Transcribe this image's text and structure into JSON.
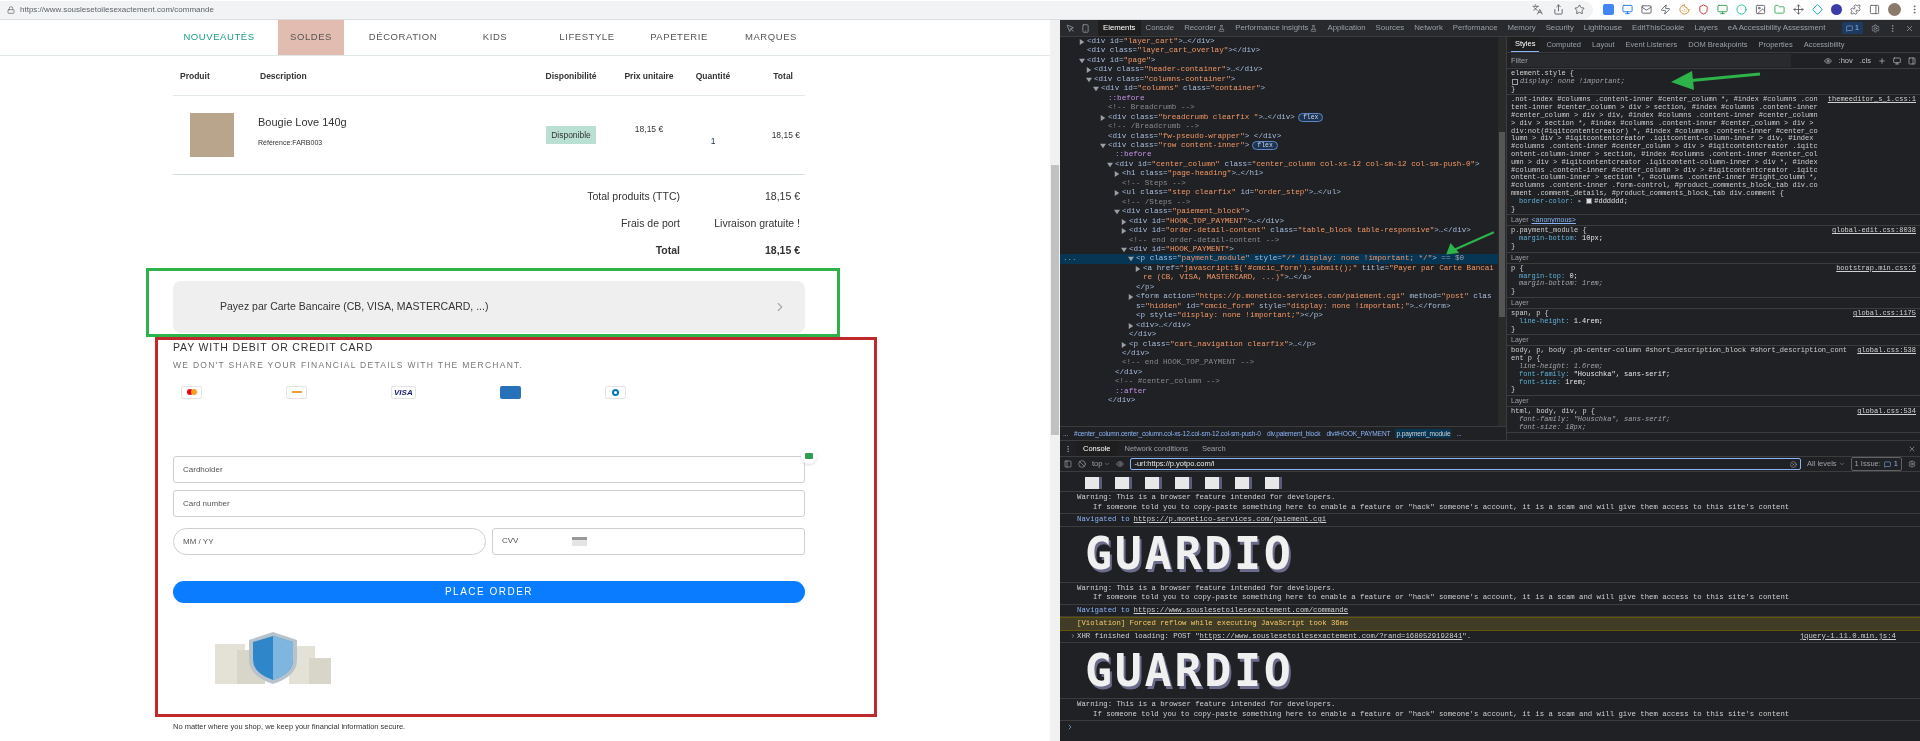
{
  "browser": {
    "url": "https://www.souslesetoilesexactement.com/commande"
  },
  "page": {
    "nav": [
      {
        "label": "NOUVEAUTÉS",
        "selected": false,
        "highlighted": true
      },
      {
        "label": "SOLDES",
        "selected": true,
        "highlighted": false
      },
      {
        "label": "DÉCORATION",
        "selected": false,
        "highlighted": false
      },
      {
        "label": "KIDS",
        "selected": false,
        "highlighted": false
      },
      {
        "label": "LIFESTYLE",
        "selected": false,
        "highlighted": false
      },
      {
        "label": "PAPETERIE",
        "selected": false,
        "highlighted": false
      },
      {
        "label": "MARQUES",
        "selected": false,
        "highlighted": false
      }
    ],
    "table": {
      "columns": [
        "Produit",
        "Description",
        "Disponibilité",
        "Prix unitaire",
        "Quantité",
        "Total"
      ],
      "rows": [
        {
          "product": "Bougie Love 140g",
          "reference": "Référence:FARB003",
          "availability": "Disponible",
          "unit_price": "18,15 €",
          "quantity": "1",
          "total": "18,15 €"
        }
      ]
    },
    "totals": [
      {
        "label": "Total produits (TTC)",
        "value": "18,15 €",
        "emphasis": false
      },
      {
        "label": "Frais de port",
        "value": "Livraison gratuite !",
        "emphasis": false
      },
      {
        "label": "Total",
        "value": "18,15 €",
        "emphasis": true
      }
    ],
    "payment_option": "Payez par Carte Bancaire (CB, VISA, MASTERCARD, ...)",
    "card_form": {
      "title": "PAY WITH DEBIT OR CREDIT CARD",
      "subtitle": "WE DON'T SHARE YOUR FINANCIAL DETAILS WITH THE MERCHANT.",
      "logos": [
        {
          "kind": "mastercard"
        },
        {
          "kind": "maestro"
        },
        {
          "kind": "visa",
          "text": "VISA"
        },
        {
          "kind": "amex"
        },
        {
          "kind": "diners"
        }
      ],
      "fields": [
        {
          "placeholder": "Cardholder"
        },
        {
          "placeholder": "Card number"
        }
      ],
      "expiry": {
        "placeholder": "MM / YY"
      },
      "cvv": {
        "placeholder": "CVV"
      },
      "button": "PLACE ORDER"
    },
    "note": "No matter where you shop, we keep your financial information secure."
  },
  "devtools": {
    "tabs": [
      {
        "label": "Elements",
        "selected": true,
        "experimental": false
      },
      {
        "label": "Console",
        "selected": false,
        "experimental": false
      },
      {
        "label": "Recorder",
        "selected": false,
        "experimental": true
      },
      {
        "label": "Performance insights",
        "selected": false,
        "experimental": true
      },
      {
        "label": "Application",
        "selected": false,
        "experimental": false
      },
      {
        "label": "Sources",
        "selected": false,
        "experimental": false
      },
      {
        "label": "Network",
        "selected": false,
        "experimental": false
      },
      {
        "label": "Performance",
        "selected": false,
        "experimental": false
      },
      {
        "label": "Memory",
        "selected": false,
        "experimental": false
      },
      {
        "label": "Security",
        "selected": false,
        "experimental": false
      },
      {
        "label": "Lighthouse",
        "selected": false,
        "experimental": false
      },
      {
        "label": "EditThisCookie",
        "selected": false,
        "experimental": false
      },
      {
        "label": "Layers",
        "selected": false,
        "experimental": false
      },
      {
        "label": "eA Accessibility Assessment",
        "selected": false,
        "experimental": false
      }
    ],
    "issues_count": "1",
    "tree": [
      {
        "text": "<div id=\"layer_cart\">…</div>",
        "kind": "tag",
        "expanded": false,
        "selected": false
      },
      {
        "text": "<div class=\"layer_cart_overlay\"></div>",
        "kind": "tag",
        "selected": false
      },
      {
        "text": "<div id=\"page\">",
        "kind": "tag",
        "expanded": true,
        "selected": false,
        "children": [
          {
            "text": "<div class=\"header-container\">…</div>",
            "kind": "tag",
            "expanded": false,
            "selected": false
          },
          {
            "text": "<div class=\"columns-container\">",
            "kind": "tag",
            "expanded": true,
            "selected": false,
            "children": [
              {
                "text": "<div id=\"columns\" class=\"container\">",
                "kind": "tag",
                "expanded": true,
                "selected": false,
                "children": [
                  {
                    "text": "::before",
                    "kind": "pseudo",
                    "selected": false
                  },
                  {
                    "text": "<!-- Breadcrumb -->",
                    "kind": "comment",
                    "selected": false
                  },
                  {
                    "text": "<div class=\"breadcrumb clearfix \">…</div>",
                    "kind": "tag",
                    "expanded": false,
                    "selected": false,
                    "badge": "flex"
                  },
                  {
                    "text": "<!-- /Breadcrumb -->",
                    "kind": "comment",
                    "selected": false
                  },
                  {
                    "text": "<div class=\"fw-pseudo-wrapper\"> </div>",
                    "kind": "tag",
                    "selected": false
                  },
                  {
                    "text": "<div class=\"row content-inner\">",
                    "kind": "tag",
                    "expanded": true,
                    "selected": false,
                    "badge": "flex",
                    "close": "</div>",
                    "children": [
                      {
                        "text": "::before",
                        "kind": "pseudo",
                        "selected": false
                      },
                      {
                        "text": "<div id=\"center_column\" class=\"center_column col-xs-12 col-sm-12  col-sm-push-0\">",
                        "kind": "tag",
                        "expanded": true,
                        "selected": false,
                        "close": "</div>",
                        "children": [
                          {
                            "text": "<h1 class=\"page-heading\">…</h1>",
                            "kind": "tag",
                            "expanded": false,
                            "selected": false
                          },
                          {
                            "text": "<!-- Steps -->",
                            "kind": "comment",
                            "selected": false
                          },
                          {
                            "text": "<ul class=\"step clearfix\" id=\"order_step\">…</ul>",
                            "kind": "tag",
                            "expanded": false,
                            "selected": false
                          },
                          {
                            "text": "<!-- /Steps -->",
                            "kind": "comment",
                            "selected": false
                          },
                          {
                            "text": "<div class=\"paiement_block\">",
                            "kind": "tag",
                            "expanded": true,
                            "selected": false,
                            "close": "</div>",
                            "children": [
                              {
                                "text": "<div id=\"HOOK_TOP_PAYMENT\">…</div>",
                                "kind": "tag",
                                "expanded": false,
                                "selected": false
                              },
                              {
                                "text": "<div id=\"order-detail-content\" class=\"table_block table-responsive\">…</div>",
                                "kind": "tag",
                                "expanded": false,
                                "selected": false
                              },
                              {
                                "text": "<!-- end order-detail-content -->",
                                "kind": "comment",
                                "selected": false
                              },
                              {
                                "text": "<div id=\"HOOK_PAYMENT\">",
                                "kind": "tag",
                                "expanded": true,
                                "selected": false,
                                "close": "</div>",
                                "children": [
                                  {
                                    "text": "<p class=\"payment_module\" style=\"/* display: none !important; */\">",
                                    "kind": "tag",
                                    "expanded": true,
                                    "selected": true,
                                    "gutter": "...",
                                    "marker": "== $0",
                                    "close": "</p>",
                                    "children": [
                                      {
                                        "text": "<a href=\"javascript:$('#cmcic_form').submit();\" title=\"Payer par Carte Bancaire (CB, VISA, MASTERCARD, ...)\">…</a>",
                                        "kind": "tag",
                                        "expanded": false,
                                        "selected": false
                                      }
                                    ]
                                  },
                                  {
                                    "text": "<form action=\"https://p.monetico-services.com/paiement.cgi\" method=\"post\" class=\"hidden\" id=\"cmcic_form\" style=\"display: none !important;\">…</form>",
                                    "kind": "tag",
                                    "expanded": false,
                                    "selected": false
                                  },
                                  {
                                    "text": "<p style=\"display: none !important;\"></p>",
                                    "kind": "tag",
                                    "selected": false
                                  },
                                  {
                                    "text": "<div>…</div>",
                                    "kind": "tag",
                                    "expanded": false,
                                    "selected": false
                                  }
                                ]
                              },
                              {
                                "text": "<p class=\"cart_navigation clearfix\">…</p>",
                                "kind": "tag",
                                "expanded": false,
                                "selected": false
                              }
                            ]
                          },
                          {
                            "text": "<!-- end HOOK_TOP_PAYMENT -->",
                            "kind": "comment",
                            "selected": false
                          }
                        ]
                      },
                      {
                        "text": "<!-- #center_column -->",
                        "kind": "comment",
                        "selected": false
                      },
                      {
                        "text": "::after",
                        "kind": "pseudo",
                        "selected": false
                      }
                    ]
                  }
                ]
              }
            ]
          }
        ]
      }
    ],
    "breadcrumbs": [
      {
        "label": "...",
        "selected": false
      },
      {
        "label": "#center_column.center_column.col-xs-12.col-sm-12.col-sm-push-0",
        "selected": false
      },
      {
        "label": "div.paiement_block",
        "selected": false
      },
      {
        "label": "div#HOOK_PAYMENT",
        "selected": false
      },
      {
        "label": "p.payment_module",
        "selected": true
      },
      {
        "label": "...",
        "selected": false
      }
    ],
    "styles": {
      "tabs": [
        {
          "label": "Styles",
          "selected": true
        },
        {
          "label": "Computed",
          "selected": false
        },
        {
          "label": "Layout",
          "selected": false
        },
        {
          "label": "Event Listeners",
          "selected": false
        },
        {
          "label": "DOM Breakpoints",
          "selected": false
        },
        {
          "label": "Properties",
          "selected": false
        },
        {
          "label": "Accessibility",
          "selected": false
        }
      ],
      "filter_placeholder": "Filter",
      "tools": [
        ":hov",
        ".cls"
      ],
      "rules": [
        {
          "selector": "element.style {",
          "props": [
            {
              "name": "display:",
              "value": "none !important;",
              "struck": true,
              "checkbox": {
                "checked": false
              }
            }
          ],
          "close": "}"
        },
        {
          "selector": ".not-index #columns .content-inner #center_column *, #index #columns .content-inner #center_column > div > section, #index #columns .content-inner #center_column > div > div, #index #columns .content-inner #center_column > div > section *, #index #columns .content-inner #center_column > div > div:not(#iqitcontentcreator) *, #index #columns .content-inner #center_column > div > #iqitcontentcreator .iqitcontent-column-inner > div, #index #columns .content-inner #center_column > div > #iqitcontentcreator .iqitcontent-column-inner > section, #index #columns .content-inner #center_column > div > #iqitcontentcreator .iqitcontent-column-inner > div *, #index #columns .content-inner #center_column > div > #iqitcontentcreator .iqitcontent-column-inner > section *, #columns .content-inner #right_column *, #columns .content-inner .form-control, #product_comments_block_tab div.comment .comment_details, #product_comments_block_tab div.comment {",
          "source": "themeeditor_s_1.css:1",
          "props": [
            {
              "name": "border-color:",
              "expander": "▸",
              "swatch": true,
              "value": "#dddddd;",
              "struck": false
            }
          ],
          "close": "}"
        },
        {
          "layer": "Layer",
          "layer_name": "<anonymous>",
          "selector": "p.payment_module {",
          "source": "global-edit.css:8038",
          "props": [
            {
              "name": "margin-bottom:",
              "value": "10px;",
              "struck": false
            }
          ],
          "close": "}"
        },
        {
          "layer": "Layer",
          "selector": "p {",
          "source": "bootstrap.min.css:6",
          "props": [
            {
              "name": "margin-top:",
              "value": "0;",
              "struck": false
            },
            {
              "name": "margin-bottom:",
              "value": "1rem;",
              "struck": true
            }
          ],
          "close": "}"
        },
        {
          "layer": "Layer",
          "selector": "span, p {",
          "source": "global.css:1175",
          "props": [
            {
              "name": "line-height:",
              "value": "1.4rem;",
              "struck": false
            }
          ],
          "close": "}"
        },
        {
          "layer": "Layer",
          "selector": "body, p, body .pb-center-column #short_description_block #short_description_content p {",
          "source": "global.css:538",
          "props": [
            {
              "name": "line-height:",
              "value": "1.6rem;",
              "struck": true
            },
            {
              "name": "font-family:",
              "value": "\"Houschka\", sans-serif;",
              "struck": false
            },
            {
              "name": "font-size:",
              "value": "1rem;",
              "struck": false
            }
          ],
          "close": "}"
        },
        {
          "layer": "Layer",
          "selector": "html, body, div, p {",
          "source": "global.css:534",
          "props": [
            {
              "name": "font-family:",
              "value": "\"Houschka\", sans-serif;",
              "struck": true
            },
            {
              "name": "font-size:",
              "value": "18px;",
              "struck": true
            }
          ]
        }
      ]
    },
    "console": {
      "tabs": [
        {
          "label": "Console",
          "selected": true
        },
        {
          "label": "Network conditions",
          "selected": false
        },
        {
          "label": "Search",
          "selected": false
        }
      ],
      "context": "top",
      "filter": "-url:https://p.yotpo.com/i",
      "levels": "All levels",
      "issues": "1 Issue:",
      "issues_count": "1",
      "messages": [
        {
          "kind": "art_fragment"
        },
        {
          "kind": "log",
          "lines": [
            "Warning: This is a browser feature intended for developers.",
            "If someone told you to copy-paste something here to enable a feature or \"hack\" someone's account, it is a scam and will give them access to this site's content"
          ]
        },
        {
          "kind": "nav",
          "text": "Navigated to",
          "link": "https://p.monetico-services.com/paiement.cgi"
        },
        {
          "kind": "art",
          "text": "GUARDIO"
        },
        {
          "kind": "log",
          "lines": [
            "Warning: This is a browser feature intended for developers.",
            "If someone told you to copy-paste something here to enable a feature or \"hack\" someone's account, it is a scam and will give them access to this site's content"
          ]
        },
        {
          "kind": "nav",
          "text": "Navigated to",
          "link": "https://www.souslesetoilesexactement.com/commande"
        },
        {
          "kind": "violation",
          "text": "[Violation] Forced reflow while executing JavaScript took 36ms"
        },
        {
          "kind": "xhr",
          "prefix": "XHR finished loading: POST \"",
          "link": "https://www.souslesetoilesexactement.com/?rand=1680529192841",
          "suffix": "\".",
          "source": "jquery-1.11.0.min.js:4"
        },
        {
          "kind": "art",
          "text": "GUARDIO"
        },
        {
          "kind": "log",
          "lines": [
            "Warning: This is a browser feature intended for developers.",
            "If someone told you to copy-paste something here to enable a feature or \"hack\" someone's account, it is a scam and will give them access to this site's content"
          ]
        },
        {
          "kind": "prompt"
        }
      ]
    }
  }
}
